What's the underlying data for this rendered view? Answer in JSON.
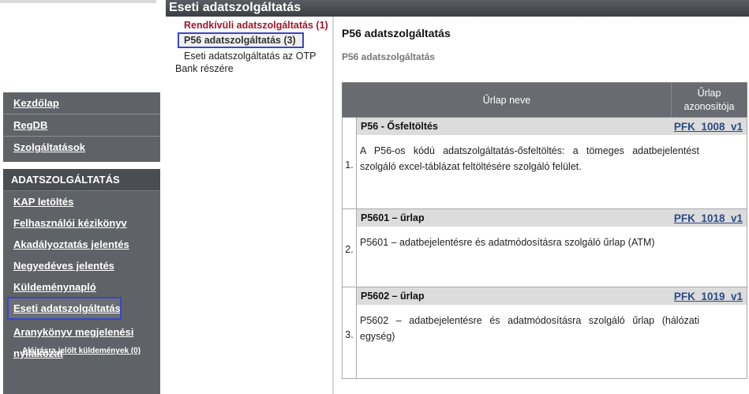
{
  "header": {
    "title": "Eseti adatszolgáltatás"
  },
  "sidebar": {
    "main_items": [
      {
        "label": "Kezdőlap"
      },
      {
        "label": "RegDB"
      },
      {
        "label": "Szolgáltatások"
      }
    ],
    "section_title": "ADATSZOLGÁLTATÁS",
    "section_items": [
      {
        "label": "KAP letöltés"
      },
      {
        "label": "Felhasználói kézikönyv"
      },
      {
        "label": "Akadályoztatás jelentés"
      },
      {
        "label": "Negyedéves jelentés"
      },
      {
        "label": "Küldeménynapló"
      },
      {
        "label": "Eseti adatszolgáltatás"
      },
      {
        "label": "Aranykönyv megjelenési nyilakozat"
      },
      {
        "label": "Aláírásra jelölt küldemények (0)"
      }
    ]
  },
  "submenu": {
    "items": [
      {
        "label": "Rendkívüli adatszolgáltatás (1)"
      },
      {
        "label": "P56 adatszolgáltatás (3)"
      },
      {
        "label_line1": "Eseti adatszolgáltatás az OTP",
        "label_line2": "Bank részére"
      }
    ]
  },
  "content": {
    "title": "P56 adatszolgáltatás",
    "subtitle": "P56 adatszolgáltatás",
    "table": {
      "col_name": "Űrlap neve",
      "col_code_line1": "Űrlap",
      "col_code_line2": "azonosítója",
      "rows": [
        {
          "num": "1.",
          "name": "P56 - Ősfeltöltés",
          "code": "PFK_1008_v1",
          "desc": "A P56-os kódú adatszolgáltatás-ősfeltöltés: a tömeges adatbejelentést szolgáló excel-táblázat feltöltésére szolgáló felület."
        },
        {
          "num": "2.",
          "name": "P5601 – űrlap",
          "code": "PFK_1018_v1",
          "desc": "P5601 – adatbejelentésre és adatmódosításra szolgáló űrlap (ATM)"
        },
        {
          "num": "3.",
          "name": "P5602 – űrlap",
          "code": "PFK_1019_v1",
          "desc": "P5602 – adatbejelentésre és adatmódosításra szolgáló űrlap (hálózati egység)"
        }
      ]
    }
  },
  "colors": {
    "sidebar_bg": "#5f6266",
    "highlight_outline": "#3a45c8",
    "emph_link": "#a3162a",
    "form_code_link": "#2c4a86"
  }
}
